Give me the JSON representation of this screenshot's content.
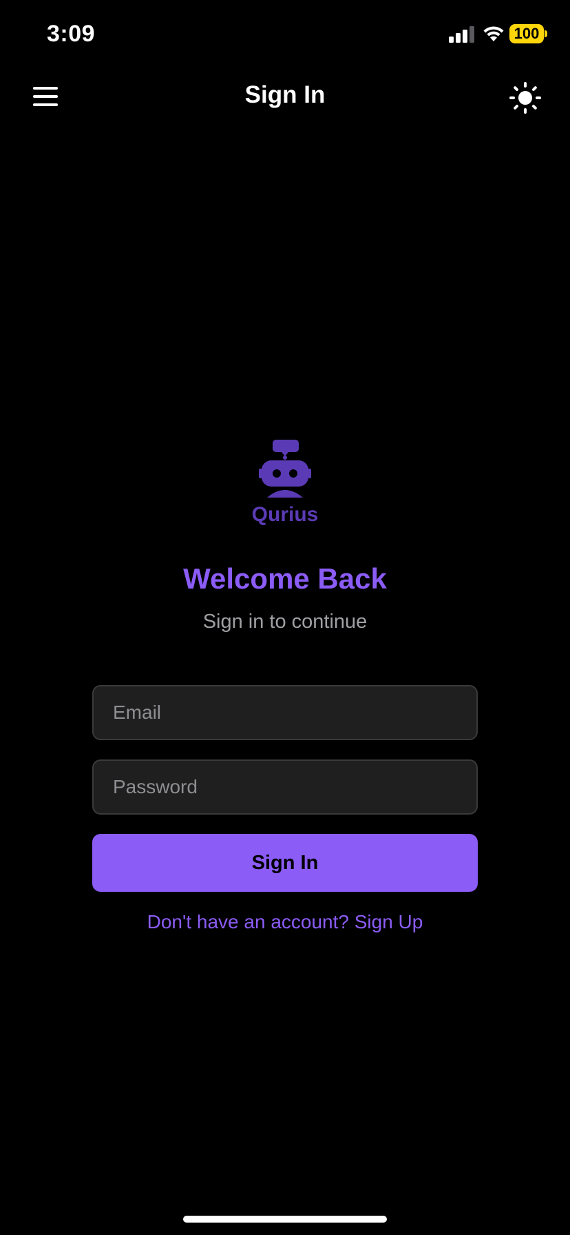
{
  "status_bar": {
    "time": "3:09",
    "battery_level": "100",
    "signal_icon": "cellular-signal-icon",
    "wifi_icon": "wifi-icon",
    "battery_color": "#ffd60a"
  },
  "nav": {
    "title": "Sign In",
    "menu_icon": "hamburger-menu-icon",
    "theme_icon": "sun-icon"
  },
  "logo": {
    "text": "Qurius",
    "icon": "robot-icon",
    "color": "#5b3bb5"
  },
  "welcome": {
    "title": "Welcome Back",
    "subtitle": "Sign in to continue"
  },
  "form": {
    "email_placeholder": "Email",
    "email_value": "",
    "password_placeholder": "Password",
    "password_value": "",
    "submit_label": "Sign In",
    "signup_link": "Don't have an account? Sign Up"
  },
  "colors": {
    "accent": "#8b5cf6",
    "background": "#000000",
    "field_background": "#1f1f1f",
    "field_border": "#3a3a3c"
  }
}
